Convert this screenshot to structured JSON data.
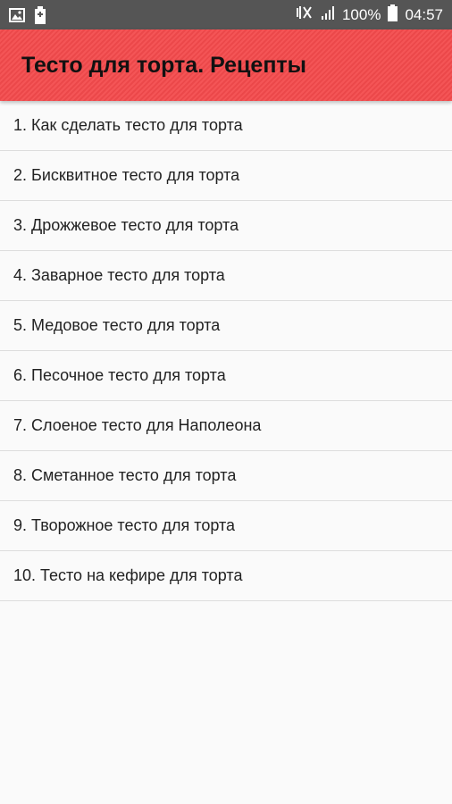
{
  "status_bar": {
    "icons_left": [
      "image-icon",
      "battery-saver-icon"
    ],
    "icons_right": [
      "vibrate-icon",
      "signal-icon"
    ],
    "battery_text": "100%",
    "time": "04:57"
  },
  "app_bar": {
    "title": "Тесто для торта. Рецепты",
    "color": "#f34a4c"
  },
  "recipes": [
    "1. Как сделать тесто для торта",
    "2. Бисквитное тесто для торта",
    "3. Дрожжевое тесто для торта",
    "4. Заварное тесто для торта",
    "5. Медовое тесто для торта",
    "6. Песочное тесто для торта",
    "7. Слоеное тесто для Наполеона",
    "8. Сметанное тесто для торта",
    "9. Творожное тесто для торта",
    "10. Тесто на кефире для торта"
  ]
}
